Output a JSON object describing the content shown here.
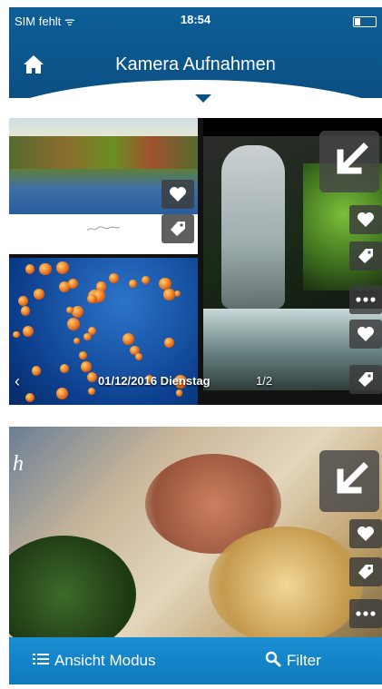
{
  "status_bar": {
    "carrier": "SIM fehlt ᯤ",
    "time": "18:54"
  },
  "header": {
    "title": "Kamera Aufnahmen"
  },
  "collage": {
    "date_caption": "01/12/2016 Dienstag",
    "page_count": "1/2",
    "nav_prev": "‹"
  },
  "food_card": {
    "letter": "h"
  },
  "bottom_bar": {
    "view_mode_label": "Ansicht Modus",
    "filter_label": "Filter"
  },
  "icons": {
    "home": "home-icon",
    "heart": "heart-icon",
    "tag": "tag-icon",
    "more": "more-icon",
    "expand": "expand-arrow-icon",
    "list": "list-icon",
    "search": "search-icon"
  },
  "colors": {
    "header": "#0a4f83",
    "bottom_bar": "#1387c9"
  }
}
